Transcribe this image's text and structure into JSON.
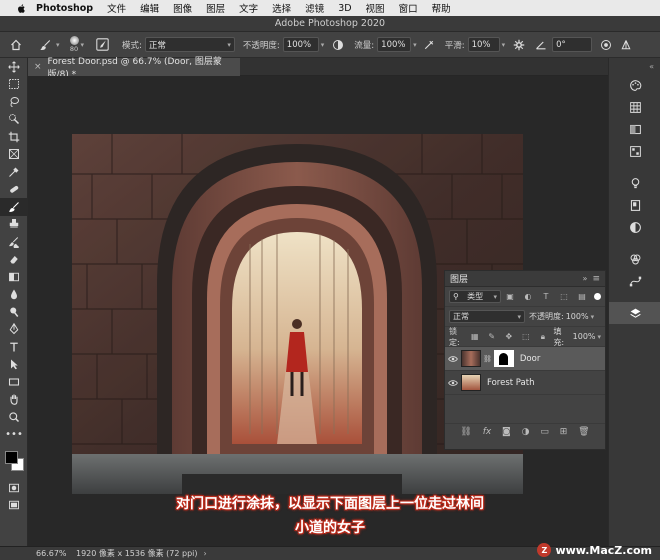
{
  "menubar": {
    "app": "Photoshop",
    "items": [
      "文件",
      "编辑",
      "图像",
      "图层",
      "文字",
      "选择",
      "滤镜",
      "3D",
      "视图",
      "窗口",
      "帮助"
    ]
  },
  "window": {
    "title": "Adobe Photoshop 2020"
  },
  "options": {
    "brush_size": "80",
    "mode_label": "模式:",
    "mode_value": "正常",
    "opacity_label": "不透明度:",
    "opacity_value": "100%",
    "flow_label": "流量:",
    "flow_value": "100%",
    "smoothing_label": "平滑:",
    "smoothing_value": "10%",
    "angle_value": "0°"
  },
  "document": {
    "tab_title": "Forest Door.psd @ 66.7% (Door, 图层蒙版/8) *"
  },
  "layers_panel": {
    "title": "图层",
    "filter_kind": "类型",
    "blend_mode": "正常",
    "opacity_label": "不透明度:",
    "opacity_value": "100%",
    "lock_label": "锁定:",
    "fill_label": "填充:",
    "fill_value": "100%",
    "layers": [
      {
        "name": "Door",
        "selected": true
      },
      {
        "name": "Forest Path",
        "selected": false
      }
    ]
  },
  "status": {
    "zoom": "66.67%",
    "dimensions": "1920 像素 x 1536 像素 (72 ppi)"
  },
  "caption": {
    "line1": "对门口进行涂抹，以显示下面图层上一位走过林间",
    "line2": "小道的女子"
  },
  "watermark": {
    "text": "www.MacZ.com"
  },
  "colors": {
    "accent": "#c2301e",
    "panel": "#434343",
    "canvas_bg": "#282828"
  }
}
